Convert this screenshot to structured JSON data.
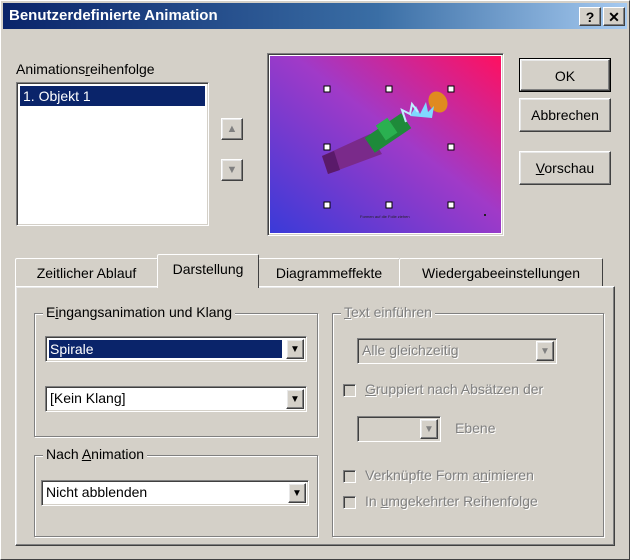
{
  "window": {
    "title": "Benutzerdefinierte Animation",
    "help_label": "?",
    "close_label": "✕"
  },
  "order": {
    "label_pre": "Animations",
    "label_u": "r",
    "label_post": "eihenfolge",
    "items": [
      "1. Objekt 1"
    ],
    "up_icon": "▲",
    "down_icon": "▼"
  },
  "buttons": {
    "ok": "OK",
    "cancel": "Abbrechen",
    "preview_u": "V",
    "preview_rest": "orschau"
  },
  "tabs": [
    "Zeitlicher Ablauf",
    "Darstellung",
    "Diagrammeffekte",
    "Wiedergabeeinstellungen"
  ],
  "entry": {
    "title_pre": "E",
    "title_u": "i",
    "title_post": "ngangsanimation und Klang",
    "effect": "Spirale",
    "sound": "[Kein Klang]"
  },
  "after": {
    "title_pre": "Nach ",
    "title_u": "A",
    "title_post": "nimation",
    "value": "Nicht abblenden"
  },
  "text_intro": {
    "title_u": "T",
    "title_post": "ext einführen",
    "mode": "Alle gleichzeitig",
    "group_pre": "",
    "group_u": "G",
    "group_post": "ruppiert nach Absätzen der",
    "level_label": "Ebene",
    "linked_pre": "Verknüpfte Form a",
    "linked_u": "n",
    "linked_post": "imieren",
    "reverse_pre": "In ",
    "reverse_u": "u",
    "reverse_post": "mgekehrter Reihenfolge"
  },
  "preview": {
    "caption": "Formen auf die Folie ziehen"
  },
  "colors": {
    "title_start": "#0a246a",
    "title_end": "#a6caf0",
    "selection": "#0a246a",
    "face": "#d4d0c8"
  }
}
